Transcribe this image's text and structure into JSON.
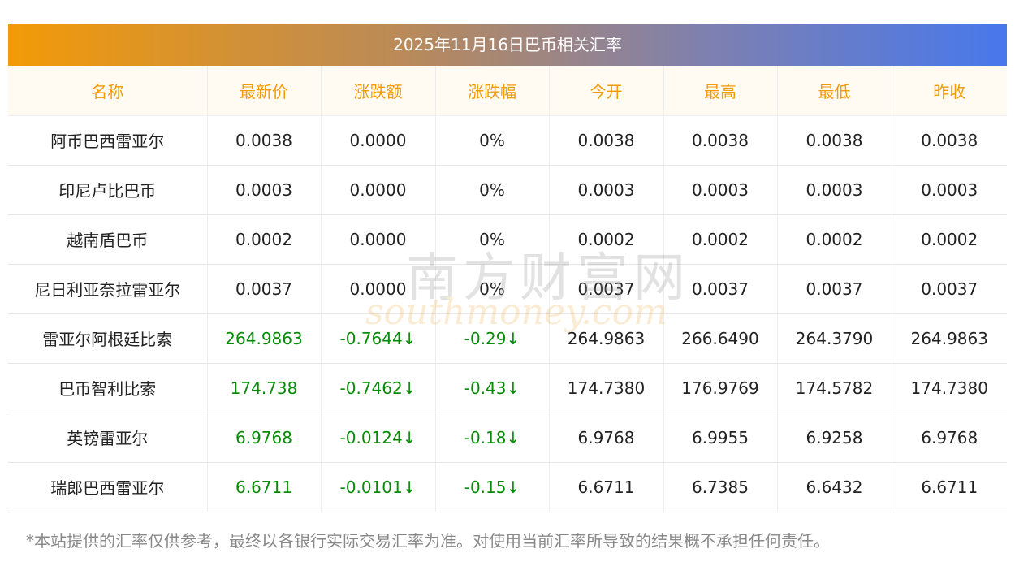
{
  "title": "2025年11月16日巴币相关汇率",
  "columns": [
    "名称",
    "最新价",
    "涨跌额",
    "涨跌幅",
    "今开",
    "最高",
    "最低",
    "昨收"
  ],
  "rows": [
    {
      "name": "阿币巴西雷亚尔",
      "latest": "0.0038",
      "change": "0.0000",
      "pct": "0%",
      "open": "0.0038",
      "high": "0.0038",
      "low": "0.0038",
      "prev": "0.0038",
      "trend": "flat"
    },
    {
      "name": "印尼卢比巴币",
      "latest": "0.0003",
      "change": "0.0000",
      "pct": "0%",
      "open": "0.0003",
      "high": "0.0003",
      "low": "0.0003",
      "prev": "0.0003",
      "trend": "flat"
    },
    {
      "name": "越南盾巴币",
      "latest": "0.0002",
      "change": "0.0000",
      "pct": "0%",
      "open": "0.0002",
      "high": "0.0002",
      "low": "0.0002",
      "prev": "0.0002",
      "trend": "flat"
    },
    {
      "name": "尼日利亚奈拉雷亚尔",
      "latest": "0.0037",
      "change": "0.0000",
      "pct": "0%",
      "open": "0.0037",
      "high": "0.0037",
      "low": "0.0037",
      "prev": "0.0037",
      "trend": "flat"
    },
    {
      "name": "雷亚尔阿根廷比索",
      "latest": "264.9863",
      "change": "-0.7644↓",
      "pct": "-0.29↓",
      "open": "264.9863",
      "high": "266.6490",
      "low": "264.3790",
      "prev": "264.9863",
      "trend": "down"
    },
    {
      "name": "巴币智利比索",
      "latest": "174.738",
      "change": "-0.7462↓",
      "pct": "-0.43↓",
      "open": "174.7380",
      "high": "176.9769",
      "low": "174.5782",
      "prev": "174.7380",
      "trend": "down"
    },
    {
      "name": "英镑雷亚尔",
      "latest": "6.9768",
      "change": "-0.0124↓",
      "pct": "-0.18↓",
      "open": "6.9768",
      "high": "6.9955",
      "low": "6.9258",
      "prev": "6.9768",
      "trend": "down"
    },
    {
      "name": "瑞郎巴西雷亚尔",
      "latest": "6.6711",
      "change": "-0.0101↓",
      "pct": "-0.15↓",
      "open": "6.6711",
      "high": "6.7385",
      "low": "6.6432",
      "prev": "6.6711",
      "trend": "down"
    }
  ],
  "footnote": "*本站提供的汇率仅供参考，最终以各银行实际交易汇率为准。对使用当前汇率所导致的结果概不承担任何责任。",
  "watermark": {
    "cn": "南方财富网",
    "en": "southmoney.com"
  },
  "colors": {
    "header_text": "#f39a07",
    "down": "#0a8a0a",
    "gradient_start": "#f39a07",
    "gradient_end": "#4878ec"
  }
}
